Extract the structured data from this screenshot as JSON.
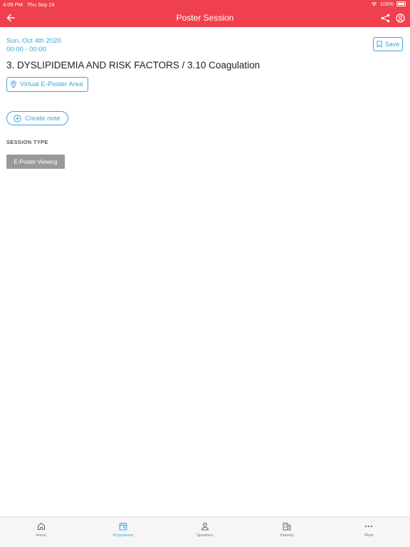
{
  "status_bar": {
    "time": "4:09 PM",
    "date": "Thu Sep 24",
    "battery": "100%"
  },
  "nav": {
    "title": "Poster Session"
  },
  "session": {
    "date": "Sun, Oct 4th 2020",
    "time": "00:00 - 00:00",
    "title": "3. DYSLIPIDEMIA AND RISK FACTORS / 3.10 Coagulation",
    "save_label": "Save",
    "location": "Virtual E-Poster Area",
    "create_note_label": "Create note",
    "session_type_label": "SESSION TYPE",
    "session_type": "E-Poster Viewing"
  },
  "tabs": [
    {
      "label": "Home",
      "icon": "home-icon"
    },
    {
      "label": "Programme",
      "icon": "calendar-icon",
      "active": true
    },
    {
      "label": "Speakers",
      "icon": "person-icon"
    },
    {
      "label": "Industry",
      "icon": "building-icon"
    },
    {
      "label": "More",
      "icon": "more-icon"
    }
  ],
  "colors": {
    "header": "#f0404d",
    "accent": "#3fa4d8",
    "tag_bg": "#999999"
  }
}
